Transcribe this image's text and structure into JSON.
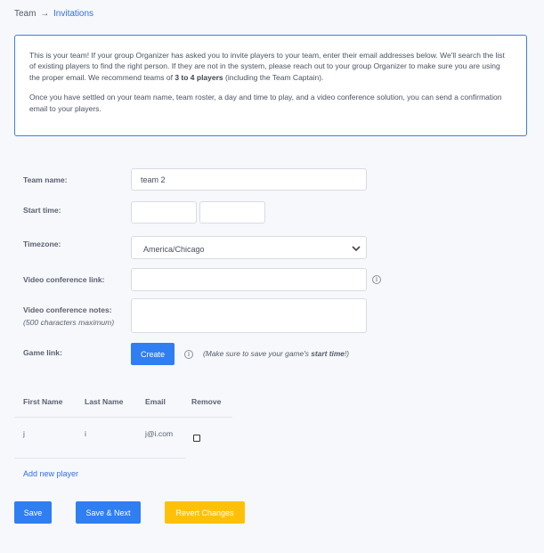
{
  "breadcrumb": {
    "parent": "Team",
    "arrow": "→",
    "current": "Invitations"
  },
  "info": {
    "p1_a": "This is your team! If your group Organizer has asked you to invite players to your team, enter their email addresses below. We'll search the list of existing players to find the right person. If they are not in the system, please reach out to your group Organizer to make sure you are using the proper email. We recommend teams of ",
    "p1_bold": "3 to 4 players",
    "p1_b": " (including the Team Captain).",
    "p2": "Once you have settled on your team name, team roster, a day and time to play, and a video conference solution, you can send a confirmation email to your players."
  },
  "form": {
    "team_name_label": "Team name:",
    "team_name_value": "team 2",
    "start_time_label": "Start time:",
    "start_date_value": "",
    "start_clock_value": "",
    "timezone_label": "Timezone:",
    "timezone_value": "America/Chicago",
    "video_link_label": "Video conference link:",
    "video_link_value": "",
    "video_notes_label": "Video conference notes:",
    "video_notes_sub": "(500 characters maximum)",
    "video_notes_value": "",
    "game_link_label": "Game link:",
    "create_button": "Create",
    "hint_a": "(Make sure to save your game's ",
    "hint_bold": "start time",
    "hint_b": "!)",
    "info_icon": "i"
  },
  "roster": {
    "headers": {
      "first": "First Name",
      "last": "Last Name",
      "email": "Email",
      "remove": "Remove"
    },
    "rows": [
      {
        "first": "j",
        "last": "i",
        "email": "j@i.com",
        "remove": false
      }
    ],
    "add_link": "Add new player"
  },
  "actions": {
    "save": "Save",
    "save_next": "Save & Next",
    "revert": "Revert Changes"
  },
  "colors": {
    "accent": "#2f7ef2",
    "warning": "#ffc107",
    "background": "#f7f8fc"
  }
}
